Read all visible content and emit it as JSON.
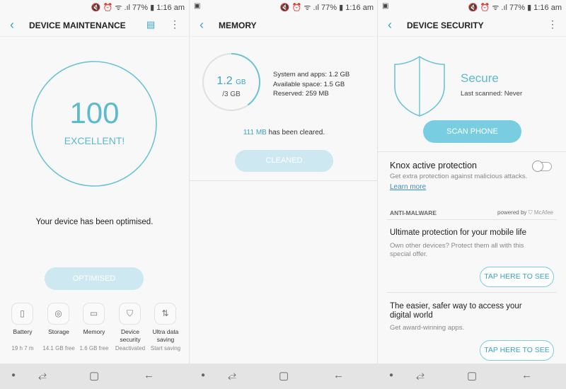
{
  "status": {
    "battery": "77%",
    "time": "1:16 am"
  },
  "maintenance": {
    "title": "DEVICE MAINTENANCE",
    "score": "100",
    "rating": "EXCELLENT!",
    "message": "Your device has been optimised.",
    "button": "OPTIMISED",
    "tiles": [
      {
        "label": "Battery",
        "sub": "19 h 7 m",
        "icon": "battery-icon"
      },
      {
        "label": "Storage",
        "sub": "14.1 GB free",
        "icon": "storage-icon"
      },
      {
        "label": "Memory",
        "sub": "1.6 GB free",
        "icon": "memory-icon"
      },
      {
        "label": "Device security",
        "sub": "Deactivated",
        "icon": "shield-icon"
      },
      {
        "label": "Ultra data saving",
        "sub": "Start saving",
        "icon": "data-saving-icon"
      }
    ]
  },
  "memory": {
    "title": "MEMORY",
    "used": "1.2",
    "used_unit": "GB",
    "total": "/3 GB",
    "used_fraction": 0.4,
    "system": "System and apps: 1.2 GB",
    "available": "Available space: 1.5 GB",
    "reserved": "Reserved: 259 MB",
    "cleared_amount": "111 MB",
    "cleared_text": " has been cleared.",
    "button": "CLEANED"
  },
  "security": {
    "title": "DEVICE SECURITY",
    "state": "Secure",
    "last_scanned": "Last scanned: Never",
    "scan_button": "SCAN PHONE",
    "knox_title": "Knox active protection",
    "knox_desc": "Get extra protection against malicious attacks.",
    "learn_more": "Learn more",
    "knox_enabled": false,
    "section": "ANTI-MALWARE",
    "powered_by": "powered by",
    "brand": "McAfee",
    "offers": [
      {
        "title": "Ultimate protection for your mobile life",
        "desc": "Own other devices? Protect them all with this special offer.",
        "button": "TAP HERE TO SEE"
      },
      {
        "title": "The easier, safer way to access your digital world",
        "desc": "Get award-winning apps.",
        "button": "TAP HERE TO SEE"
      }
    ]
  },
  "colors": {
    "accent": "#6cc3d5",
    "button_disabled": "#cde8f0",
    "button_active": "#79cde0"
  }
}
